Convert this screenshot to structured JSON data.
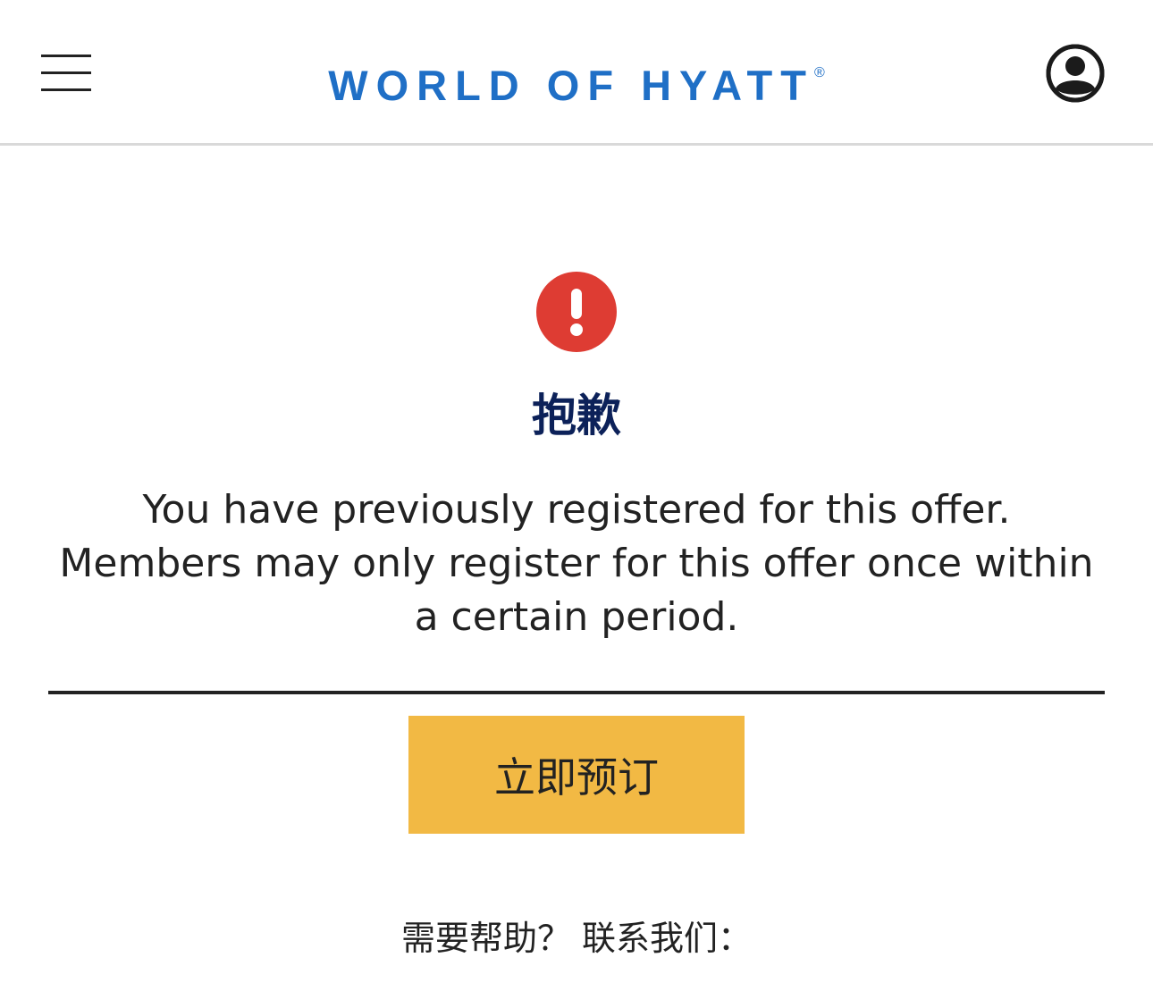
{
  "header": {
    "brand": "WORLD OF HYATT",
    "registered_mark": "®",
    "menu_icon": "hamburger-menu-icon",
    "account_icon": "user-account-icon"
  },
  "alert": {
    "icon": "exclamation-circle-icon",
    "icon_color": "#de3c33",
    "title": "抱歉",
    "message": "You have previously registered for this offer. Members may only register for this offer once within a certain period."
  },
  "actions": {
    "book_now_label": "立即预订",
    "button_color": "#f2b944"
  },
  "footer": {
    "help_text": "需要帮助？ 联系我们："
  },
  "colors": {
    "brand_blue": "#1f6fc6",
    "title_navy": "#0c2159"
  }
}
